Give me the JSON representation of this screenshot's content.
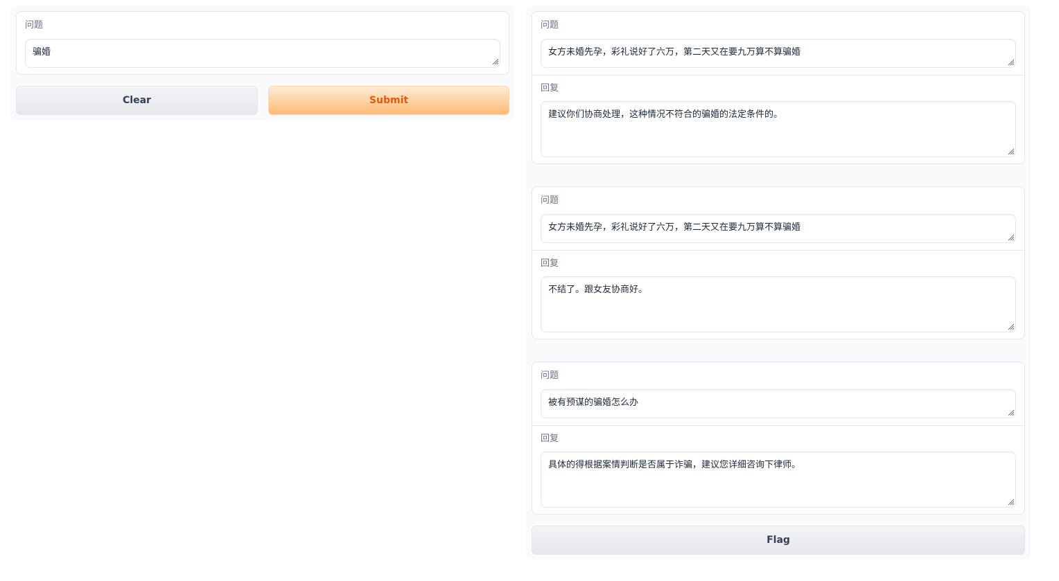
{
  "input": {
    "question_label": "问题",
    "question_value": "骗婚"
  },
  "buttons": {
    "clear_label": "Clear",
    "submit_label": "Submit",
    "flag_label": "Flag"
  },
  "colors": {
    "primary_text": "#ea580c",
    "primary_bg_top": "#ffedd5",
    "primary_bg_bottom": "#fdba74",
    "panel_bg": "#f9fafb",
    "border": "#e5e7eb"
  },
  "examples": [
    {
      "question_label": "问题",
      "question_value": "女方未婚先孕，彩礼说好了六万，第二天又在要九万算不算骗婚",
      "answer_label": "回复",
      "answer_value": "建议你们协商处理，这种情况不符合的骗婚的法定条件的。"
    },
    {
      "question_label": "问题",
      "question_value": "女方未婚先孕，彩礼说好了六万，第二天又在要九万算不算骗婚",
      "answer_label": "回复",
      "answer_value": "不结了。跟女友协商好。"
    },
    {
      "question_label": "问题",
      "question_value": "被有预谋的骗婚怎么办",
      "answer_label": "回复",
      "answer_value": "具体的得根据案情判断是否属于诈骗，建议您详细咨询下律师。"
    }
  ]
}
